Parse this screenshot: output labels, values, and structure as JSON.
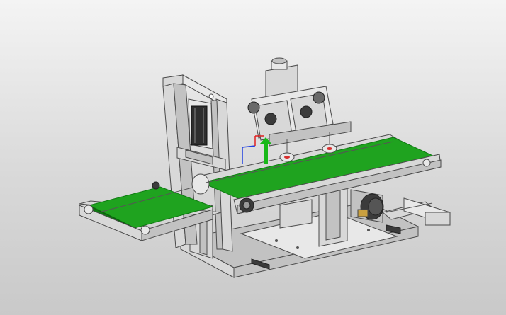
{
  "colors": {
    "background_top": "#f4f4f4",
    "background_bottom": "#c9c9c9",
    "belt": "#1fa31f",
    "belt_dark": "#0f7a12",
    "frame": "#d8d8d8",
    "motor": "#3b3b3b",
    "triad_x": "#e02020",
    "triad_y": "#18b818",
    "triad_z": "#2040e0"
  },
  "icons": [
    "triad-axes-icon"
  ]
}
